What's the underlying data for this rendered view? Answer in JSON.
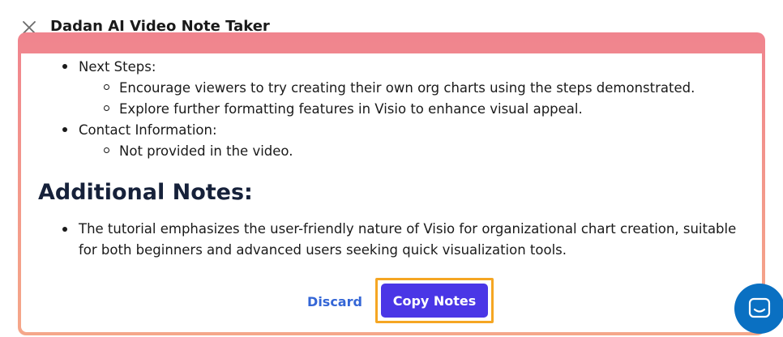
{
  "header": {
    "title": "Dadan AI Video Note Taker"
  },
  "notes": {
    "next_steps": {
      "label": "Next Steps:",
      "items": [
        "Encourage viewers to try creating their own org charts using the steps demonstrated.",
        "Explore further formatting features in Visio to enhance visual appeal."
      ]
    },
    "contact": {
      "label": "Contact Information:",
      "items": [
        "Not provided in the video."
      ]
    },
    "additional": {
      "heading": "Additional Notes:",
      "items": [
        "The tutorial emphasizes the user-friendly nature of Visio for organizational chart creation, suitable for both beginners and advanced users seeking quick visualization tools."
      ]
    }
  },
  "actions": {
    "discard_label": "Discard",
    "copy_label": "Copy Notes"
  },
  "icons": {
    "close": "close-icon",
    "chat": "chat-icon"
  },
  "colors": {
    "primary_button": "#4a36e6",
    "focus_ring": "#f5a623",
    "link": "#3466d6",
    "panel_border_top": "#f0848e",
    "panel_border_bottom": "#f5a78a",
    "chat_fab": "#0a70c2"
  }
}
